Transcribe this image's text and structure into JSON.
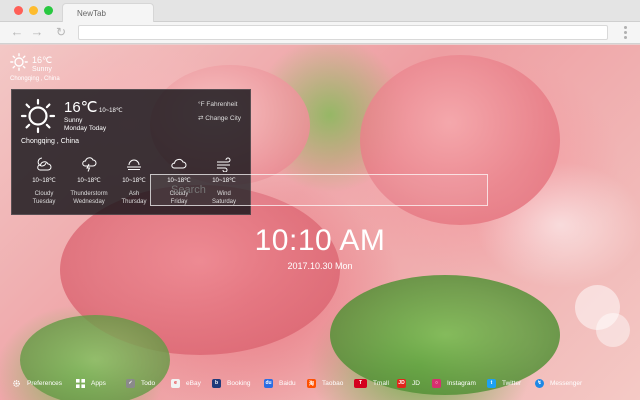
{
  "browser": {
    "tab_title": "NewTab"
  },
  "weather_widget": {
    "temp": "16℃",
    "condition": "Sunny",
    "city": "Chongqing , China"
  },
  "weather_panel": {
    "temp": "16℃",
    "range": "10~18℃",
    "condition": "Sunny",
    "day": "Monday Today",
    "city": "Chongqing , China",
    "fahrenheit_label": "°F  Fahrenheit",
    "change_city_label": "Change City",
    "forecast": [
      {
        "icon": "cloudy-night-icon",
        "range": "10~18℃",
        "condition": "Cloudy",
        "day": "Tuesday"
      },
      {
        "icon": "thunderstorm-icon",
        "range": "10~18℃",
        "condition": "Thunderstorm",
        "day": "Wednesday"
      },
      {
        "icon": "ash-haze-icon",
        "range": "10~18℃",
        "condition": "Ash",
        "day": "Thursday"
      },
      {
        "icon": "cloud-icon",
        "range": "10~18℃",
        "condition": "Cloudy",
        "day": "Friday"
      },
      {
        "icon": "wind-icon",
        "range": "10~18℃",
        "condition": "Wind",
        "day": "Saturday"
      }
    ]
  },
  "search": {
    "placeholder": "Search"
  },
  "clock": {
    "time": "10:10 AM",
    "date": "2017.10.30 Mon"
  },
  "bottom_bar": {
    "items": [
      {
        "label": "Preferences",
        "icon": "gear-icon",
        "color": "#444444"
      },
      {
        "label": "Apps",
        "icon": "apps-grid-icon",
        "color": "#555555"
      },
      {
        "label": "Todo",
        "icon": "todo-check-icon",
        "color": "#6a6a6a"
      },
      {
        "label": "eBay",
        "icon": "ebay-icon",
        "color": "#f2f2f2"
      },
      {
        "label": "Booking",
        "icon": "booking-icon",
        "color": "#1f3a7a"
      },
      {
        "label": "Baidu",
        "icon": "baidu-icon",
        "color": "#2b6de3"
      },
      {
        "label": "Taobao",
        "icon": "taobao-icon",
        "color": "#ff5000"
      },
      {
        "label": "Tmall",
        "icon": "tmall-icon",
        "color": "#d4001e"
      },
      {
        "label": "JD",
        "icon": "jd-icon",
        "color": "#e1251b"
      },
      {
        "label": "Instagram",
        "icon": "instagram-icon",
        "color": "#d6306f"
      },
      {
        "label": "Twitter",
        "icon": "twitter-icon",
        "color": "#1da1f2"
      },
      {
        "label": "Messenger",
        "icon": "messenger-icon",
        "color": "#1e88e5"
      }
    ]
  }
}
